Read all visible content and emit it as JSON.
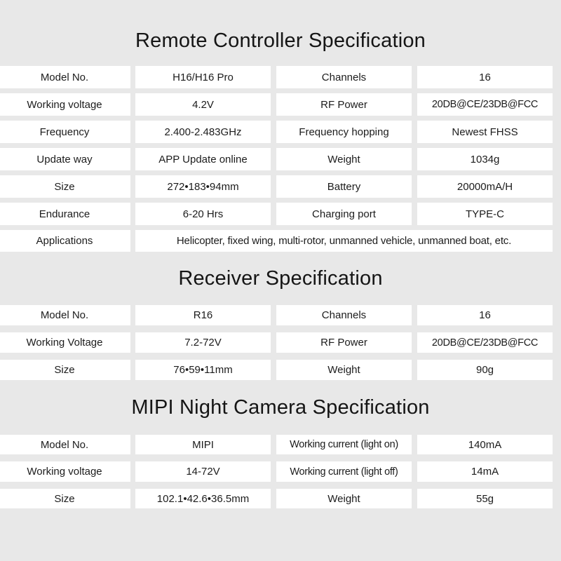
{
  "sections": [
    {
      "title": "Remote Controller Specification",
      "rows": [
        {
          "label1": "Model No.",
          "value1": "H16/H16 Pro",
          "label2": "Channels",
          "value2": "16"
        },
        {
          "label1": "Working voltage",
          "value1": "4.2V",
          "label2": "RF Power",
          "value2": "20DB@CE/23DB@FCC"
        },
        {
          "label1": "Frequency",
          "value1": "2.400-2.483GHz",
          "label2": "Frequency hopping",
          "value2": "Newest FHSS"
        },
        {
          "label1": "Update way",
          "value1": "APP Update online",
          "label2": "Weight",
          "value2": "1034g"
        },
        {
          "label1": "Size",
          "value1": "272•183•94mm",
          "label2": "Battery",
          "value2": "20000mA/H"
        },
        {
          "label1": "Endurance",
          "value1": "6-20 Hrs",
          "label2": "Charging port",
          "value2": "TYPE-C"
        },
        {
          "label1": "Applications",
          "value_span": "Helicopter, fixed wing, multi-rotor, unmanned vehicle, unmanned boat, etc."
        }
      ]
    },
    {
      "title": "Receiver Specification",
      "rows": [
        {
          "label1": "Model No.",
          "value1": "R16",
          "label2": "Channels",
          "value2": "16"
        },
        {
          "label1": "Working Voltage",
          "value1": "7.2-72V",
          "label2": "RF Power",
          "value2": "20DB@CE/23DB@FCC"
        },
        {
          "label1": "Size",
          "value1": "76•59•11mm",
          "label2": "Weight",
          "value2": "90g"
        }
      ]
    },
    {
      "title": "MIPI Night Camera Specification",
      "rows": [
        {
          "label1": "Model No.",
          "value1": "MIPI",
          "label2": "Working current (light on)",
          "value2": "140mA"
        },
        {
          "label1": "Working voltage",
          "value1": "14-72V",
          "label2": "Working current (light off)",
          "value2": "14mA"
        },
        {
          "label1": "Size",
          "value1": "102.1•42.6•36.5mm",
          "label2": "Weight",
          "value2": "55g"
        }
      ]
    }
  ],
  "colors": {
    "background": "#e8e8e8",
    "cell": "#ffffff",
    "text": "#1c1c1c"
  }
}
